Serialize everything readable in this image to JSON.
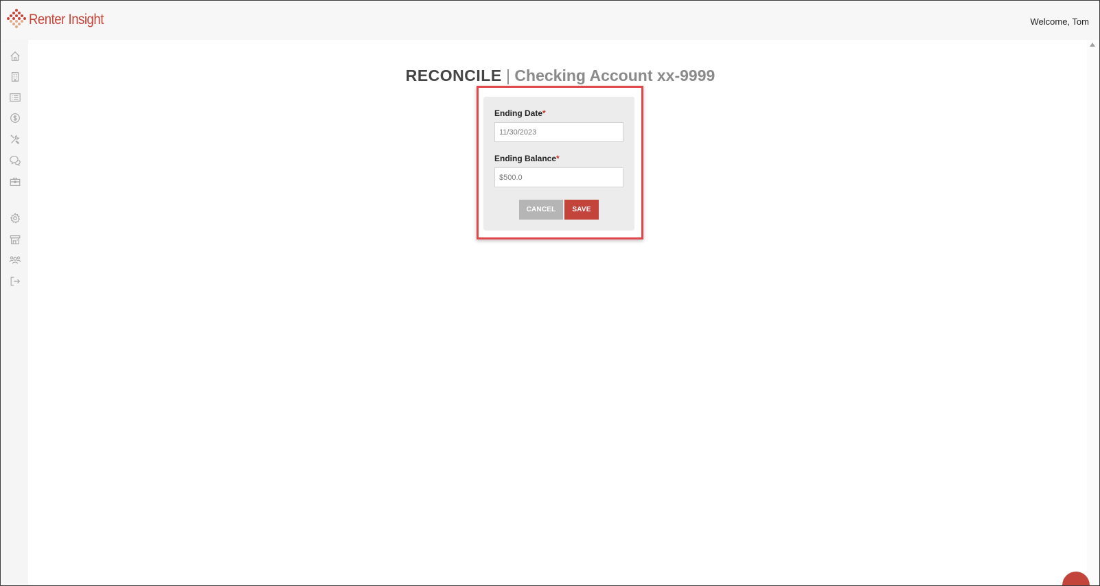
{
  "app": {
    "logo_text": "Renter Insight",
    "welcome_text": "Welcome, Tom"
  },
  "sidebar": {
    "items": [
      {
        "icon": "home-icon"
      },
      {
        "icon": "building-icon"
      },
      {
        "icon": "list-icon"
      },
      {
        "icon": "dollar-icon"
      },
      {
        "icon": "tools-icon"
      },
      {
        "icon": "chat-icon"
      },
      {
        "icon": "briefcase-icon"
      },
      {
        "icon": "gear-icon"
      },
      {
        "icon": "store-icon"
      },
      {
        "icon": "users-icon"
      },
      {
        "icon": "logout-icon"
      }
    ]
  },
  "page": {
    "title_main": "RECONCILE",
    "title_separator": " | ",
    "title_sub": "Checking Account xx-9999"
  },
  "form": {
    "ending_date_label": "Ending Date",
    "ending_date_value": "11/30/2023",
    "ending_balance_label": "Ending Balance",
    "ending_balance_value": "$500.0",
    "required_marker": "*",
    "cancel_label": "CANCEL",
    "save_label": "SAVE"
  },
  "colors": {
    "brand": "#c8453a",
    "highlight": "#e0484e",
    "cancel": "#b5b5b5",
    "save": "#c3443a"
  }
}
